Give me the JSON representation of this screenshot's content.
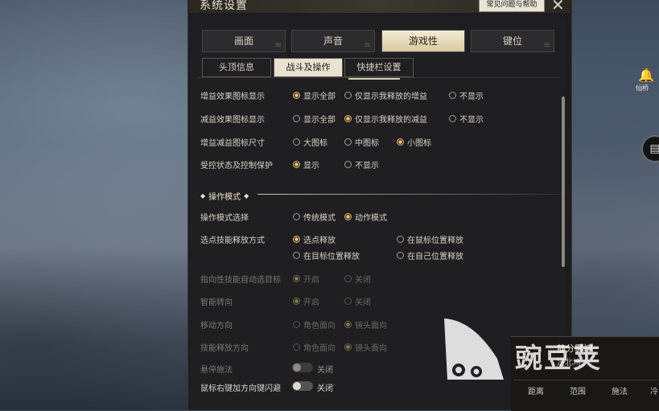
{
  "window": {
    "title": "系统设置",
    "help_button": "常见问题与帮助",
    "close": "✕"
  },
  "top_tabs": [
    {
      "label": "画面",
      "active": false
    },
    {
      "label": "声音",
      "active": false
    },
    {
      "label": "游戏性",
      "active": true
    },
    {
      "label": "键位",
      "active": false
    }
  ],
  "sub_tabs": [
    {
      "label": "头顶信息",
      "active": false
    },
    {
      "label": "战斗及操作",
      "active": true
    },
    {
      "label": "快捷栏设置",
      "active": false
    }
  ],
  "rows": {
    "buff_icon": {
      "label": "增益效果图标显示",
      "options": [
        "显示全部",
        "仅显示我释放的增益",
        "不显示"
      ],
      "selected": 0
    },
    "debuff_icon": {
      "label": "减益效果图标显示",
      "options": [
        "显示全部",
        "仅显示我释放的减益",
        "不显示"
      ],
      "selected": 1
    },
    "icon_size": {
      "label": "增益减益图标尺寸",
      "options": [
        "大图标",
        "中图标",
        "小图标"
      ],
      "selected": 2
    },
    "control_state": {
      "label": "受控状态及控制保护",
      "options": [
        "显示",
        "不显示"
      ],
      "selected": 0
    }
  },
  "section": {
    "title": "操作模式"
  },
  "op": {
    "mode": {
      "label": "操作模式选择",
      "options": [
        "传统模式",
        "动作模式"
      ],
      "selected": 1
    },
    "cast": {
      "label": "选点技能释放方式",
      "options": [
        "选点释放",
        "在鼠标位置释放",
        "在目标位置释放",
        "在自己位置释放"
      ],
      "selected": 0
    },
    "auto_target": {
      "label": "指向性技能自动选目标",
      "options": [
        "开启",
        "关闭"
      ],
      "selected": 0
    },
    "smart_turn": {
      "label": "智能转向",
      "options": [
        "开启",
        "关闭"
      ],
      "selected": 0
    },
    "move_dir": {
      "label": "移动方向",
      "options": [
        "角色面向",
        "镜头面向"
      ],
      "selected": 1
    },
    "skill_dir": {
      "label": "技能释放方向",
      "options": [
        "角色面向",
        "镜头面向"
      ],
      "selected": 1
    },
    "hover": {
      "label": "悬停施法",
      "state": "关闭"
    },
    "rmb_dodge": {
      "label": "鼠标右键加方向键闪避",
      "state": "关闭"
    }
  },
  "side": {
    "label": "仙桥"
  },
  "game_panel": {
    "title": "静分雾坤",
    "subtitle": "定北坞",
    "columns": [
      "距离",
      "范围",
      "施法",
      "冷"
    ]
  },
  "watermark": "豌豆荚"
}
